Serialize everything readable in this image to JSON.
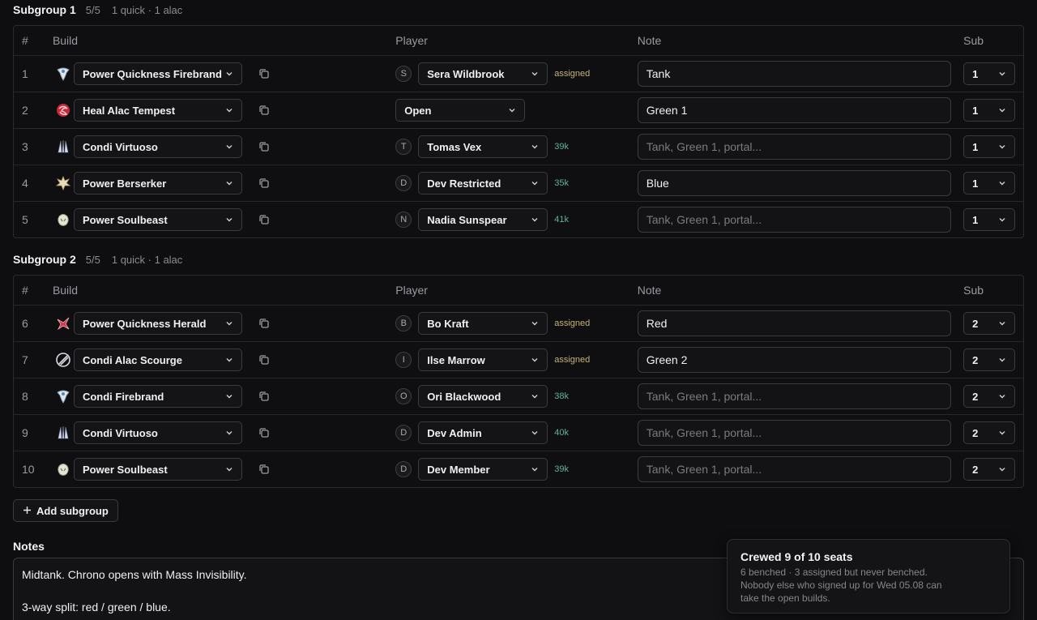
{
  "columns": {
    "num": "#",
    "build": "Build",
    "player": "Player",
    "note": "Note",
    "sub": "Sub"
  },
  "note_placeholder": "Tank, Green 1, portal...",
  "subgroups": [
    {
      "title": "Subgroup 1",
      "count": "5/5",
      "meta": "1 quick · 1 alac",
      "rows": [
        {
          "num": "1",
          "build": "Power Quickness Firebrand",
          "icon": "firebrand-icon",
          "player": "Sera Wildbrook",
          "initial": "S",
          "tag": "assigned",
          "note": "Tank",
          "sub": "1"
        },
        {
          "num": "2",
          "build": "Heal Alac Tempest",
          "icon": "tempest-icon",
          "player": "Open",
          "initial": "",
          "tag": "",
          "note": "Green 1",
          "sub": "1"
        },
        {
          "num": "3",
          "build": "Condi Virtuoso",
          "icon": "virtuoso-icon",
          "player": "Tomas Vex",
          "initial": "T",
          "tag": "39k",
          "note": "",
          "sub": "1"
        },
        {
          "num": "4",
          "build": "Power Berserker",
          "icon": "berserker-icon",
          "player": "Dev Restricted",
          "initial": "D",
          "tag": "35k",
          "note": "Blue",
          "sub": "1"
        },
        {
          "num": "5",
          "build": "Power Soulbeast",
          "icon": "soulbeast-icon",
          "player": "Nadia Sunspear",
          "initial": "N",
          "tag": "41k",
          "note": "",
          "sub": "1"
        }
      ]
    },
    {
      "title": "Subgroup 2",
      "count": "5/5",
      "meta": "1 quick · 1 alac",
      "rows": [
        {
          "num": "6",
          "build": "Power Quickness Herald",
          "icon": "herald-icon",
          "player": "Bo Kraft",
          "initial": "B",
          "tag": "assigned",
          "note": "Red",
          "sub": "2"
        },
        {
          "num": "7",
          "build": "Condi Alac Scourge",
          "icon": "scourge-icon",
          "player": "Ilse Marrow",
          "initial": "I",
          "tag": "assigned",
          "note": "Green 2",
          "sub": "2"
        },
        {
          "num": "8",
          "build": "Condi Firebrand",
          "icon": "firebrand-icon",
          "player": "Ori Blackwood",
          "initial": "O",
          "tag": "38k",
          "note": "",
          "sub": "2"
        },
        {
          "num": "9",
          "build": "Condi Virtuoso",
          "icon": "virtuoso-icon",
          "player": "Dev Admin",
          "initial": "D",
          "tag": "40k",
          "note": "",
          "sub": "2"
        },
        {
          "num": "10",
          "build": "Power Soulbeast",
          "icon": "soulbeast-icon",
          "player": "Dev Member",
          "initial": "D",
          "tag": "39k",
          "note": "",
          "sub": "2"
        }
      ]
    }
  ],
  "add_subgroup_label": "Add subgroup",
  "notes": {
    "label": "Notes",
    "line1": "Midtank. Chrono opens with Mass Invisibility.",
    "line2": "3-way split: red / green / blue."
  },
  "toast": {
    "title": "Crewed 9 of 10 seats",
    "line1": "6 benched · 3 assigned but never benched.",
    "line2": "Nobody else who signed up for Wed 05.08 can",
    "line3": "take the open builds."
  },
  "colors": {
    "assigned": "#c3b27a",
    "power": "#5fb39a",
    "background": "#0e0e10"
  }
}
